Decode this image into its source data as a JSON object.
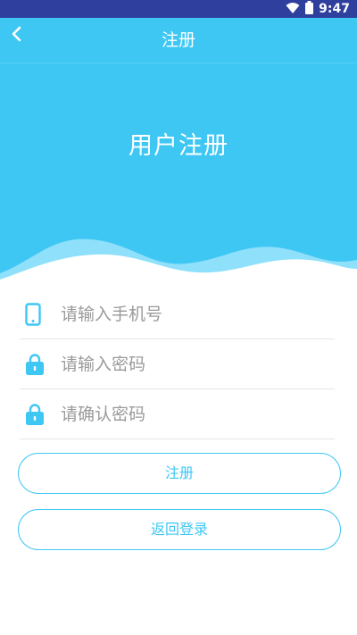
{
  "status_bar": {
    "time": "9:47",
    "icons": [
      "wifi-icon",
      "battery-icon"
    ],
    "color": "#2f3f9e"
  },
  "app_bar": {
    "title": "注册",
    "back_icon": "chevron-left-icon",
    "color": "#3fc7f4"
  },
  "hero": {
    "title": "用户注册"
  },
  "form": {
    "phone": {
      "placeholder": "请输入手机号",
      "value": "",
      "icon": "phone-icon"
    },
    "password": {
      "placeholder": "请输入密码",
      "value": "",
      "icon": "lock-icon"
    },
    "confirm_password": {
      "placeholder": "请确认密码",
      "value": "",
      "icon": "lock-icon"
    }
  },
  "buttons": {
    "register_label": "注册",
    "back_login_label": "返回登录"
  },
  "colors": {
    "accent": "#3fc7f4",
    "wave_light": "#8fe0fa",
    "divider": "#e6e6e6",
    "placeholder": "#9a9a9a"
  }
}
